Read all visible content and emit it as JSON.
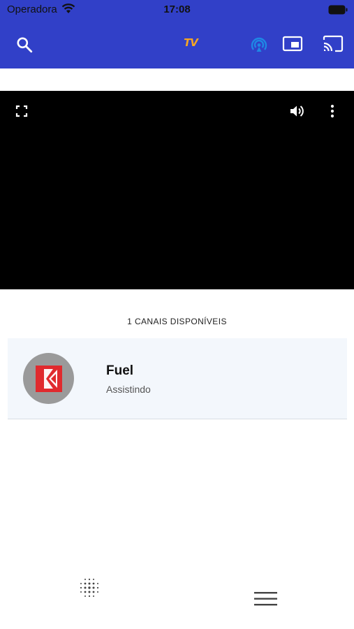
{
  "status_bar": {
    "carrier": "Operadora",
    "time": "17:08"
  },
  "app_bar": {
    "logo_text": "TV",
    "icons": [
      "search-icon",
      "live-broadcast-icon",
      "picture-in-picture-icon",
      "cast-icon"
    ]
  },
  "player": {
    "icons": [
      "fullscreen-icon",
      "volume-icon",
      "more-vert-icon"
    ]
  },
  "channels": {
    "count_label": "1 CANAIS DISPONÍVEIS",
    "items": [
      {
        "name": "Fuel",
        "status": "Assistindo",
        "logo_icon": "fuel-tv-logo"
      }
    ]
  },
  "bottom_nav": {
    "icons": [
      "dot-grid-icon",
      "menu-icon"
    ]
  },
  "colors": {
    "app_bar": "#3140c8",
    "logo": "#f5a623",
    "player_bg": "#000000",
    "card_bg": "#f3f7fc",
    "live_icon": "#1e88e5"
  }
}
